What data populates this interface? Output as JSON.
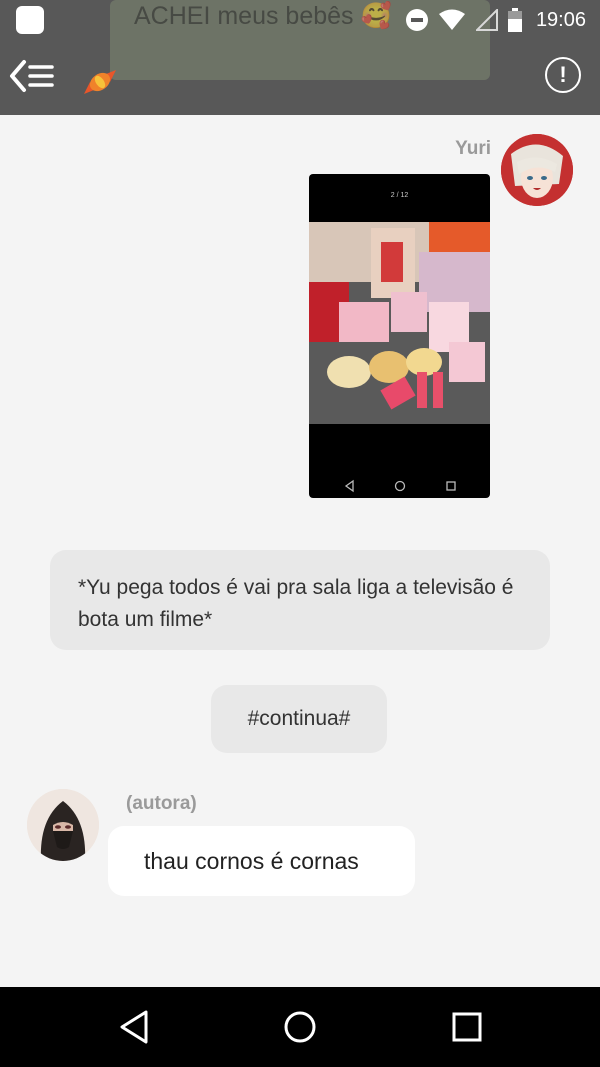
{
  "status_bar": {
    "time": "19:06",
    "icons": [
      "app-notification-icon",
      "do-not-disturb-icon",
      "wifi-icon",
      "signal-icon",
      "battery-icon"
    ]
  },
  "header": {
    "ghost_title": "ACHEI meus bebês 🥰",
    "back_icon": "back-menu-icon",
    "candy_icon": "candy-icon",
    "info_label": "!"
  },
  "messages": [
    {
      "sender": "Yuri",
      "type": "image",
      "image_counter": "2 / 12",
      "image_desc": "photo-of-snacks"
    },
    {
      "type": "narration",
      "text": "*Yu pega todos é vai pra sala liga a televisão é bota um filme*"
    },
    {
      "type": "narration",
      "text": "#continua#"
    },
    {
      "sender": "(autora)",
      "type": "text",
      "text": "thau cornos é cornas"
    }
  ],
  "colors": {
    "topbar": "#585858",
    "background": "#f4f4f4",
    "narration_bubble": "#e8e8e8",
    "text_bubble": "#ffffff",
    "name_text": "#9a9a9a"
  }
}
